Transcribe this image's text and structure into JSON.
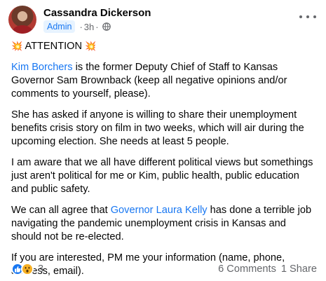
{
  "post": {
    "author": "Cassandra Dickerson",
    "badge": "Admin",
    "separator": "·",
    "time": "3h",
    "visibility_icon": "globe-icon",
    "more_icon": "more-horizontal-icon",
    "headline": {
      "left_emoji": "💥",
      "text": "ATTENTION",
      "right_emoji": "💥"
    },
    "paragraphs": {
      "p1_link": "Kim Borchers",
      "p1_text": " is the former Deputy Chief of Staff to Kansas Governor Sam Brownback (keep all negative opinions and/or comments to yourself, please).",
      "p2": "She has asked if anyone is willing to share their unemployment benefits crisis story on film in two weeks, which will air during the upcoming election. She needs at least 5 people.",
      "p3": "I am aware that we all have different political views but somethings just aren't political for me or Kim, public health, public education and public safety.",
      "p4_before": "We can all agree that ",
      "p4_link": "Governor Laura Kelly",
      "p4_after": " has done a terrible job navigating the pandemic unemployment crisis in Kansas and should not be re-elected.",
      "p5": "If you are interested, PM me your information (name, phone, address, email)."
    },
    "footer": {
      "reactions": [
        "like-reaction-icon",
        "wow-reaction-icon"
      ],
      "reaction_count": "3",
      "comments": "6 Comments",
      "shares": "1 Share"
    },
    "colors": {
      "link": "#1877f2",
      "secondary_text": "#65676b",
      "primary_text": "#050505"
    }
  }
}
